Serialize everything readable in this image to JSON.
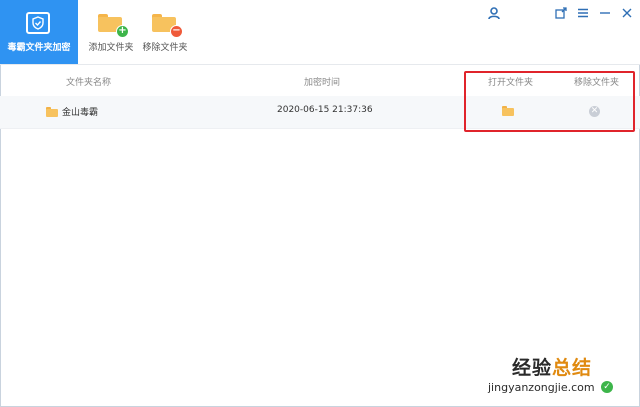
{
  "toolbar": {
    "encrypt_folder_label": "毒霸文件夹加密",
    "add_folder_label": "添加文件夹",
    "remove_folder_label": "移除文件夹"
  },
  "window_controls": {
    "user_icon": "user-icon",
    "pin_icon": "pin-icon",
    "menu_icon": "menu-icon",
    "minimize_icon": "minimize-icon",
    "close_icon": "close-icon"
  },
  "table": {
    "columns": {
      "name": "文件夹名称",
      "time": "加密时间",
      "open": "打开文件夹",
      "remove": "移除文件夹"
    },
    "rows": [
      {
        "name": "金山毒霸",
        "time": "2020-06-15 21:37:36"
      }
    ]
  },
  "watermark": {
    "title_prefix": "经验",
    "title_accent": "总结",
    "subtitle": "jingyanzongjie.com"
  },
  "colors": {
    "accent_blue": "#2f93f2",
    "folder_yellow": "#f7c25e",
    "add_green": "#3db54a",
    "remove_red": "#ef5a3a",
    "highlight_red": "#e0242b"
  }
}
